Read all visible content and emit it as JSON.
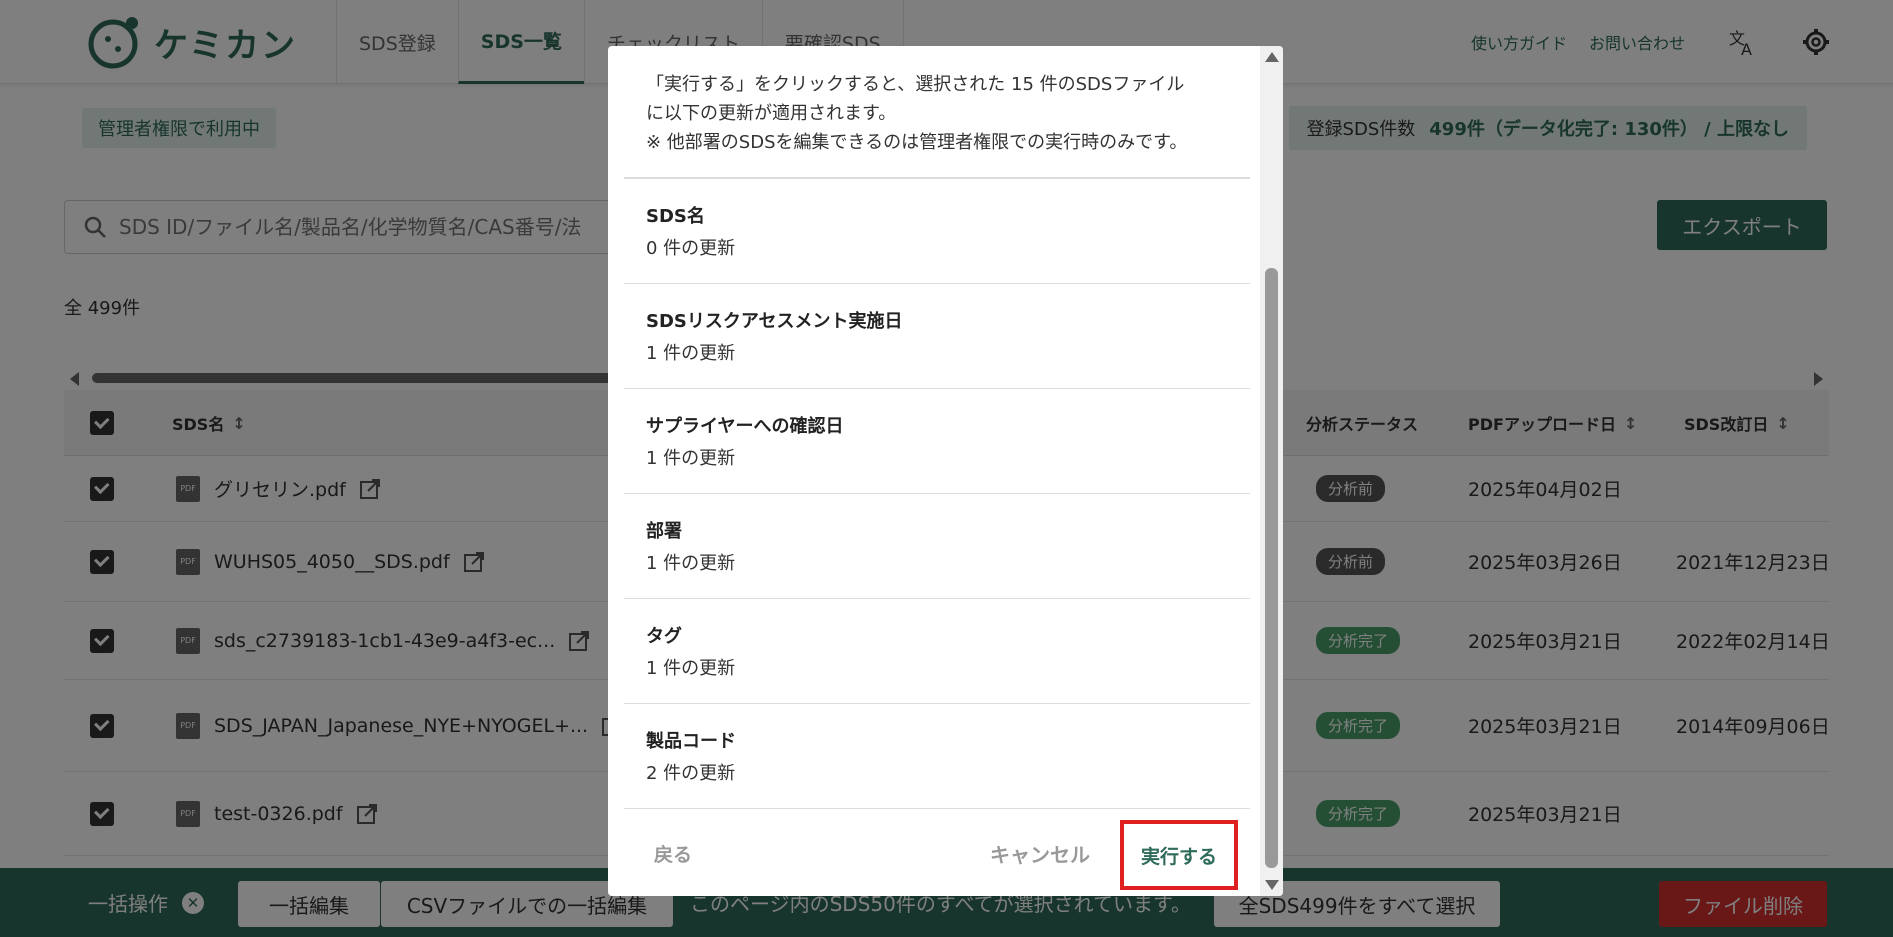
{
  "app": {
    "logo_text": "ケミカン"
  },
  "nav": {
    "tabs": [
      {
        "label": "SDS登録"
      },
      {
        "label": "SDS一覧"
      },
      {
        "label": "チェックリスト"
      },
      {
        "label": "要確認SDS"
      }
    ],
    "active_index": 1
  },
  "header": {
    "guide_link": "使い方ガイド",
    "contact_link": "お問い合わせ"
  },
  "page": {
    "admin_badge": "管理者権限で利用中",
    "sds_count_label": "登録SDS件数",
    "sds_count_value": "499件（データ化完了: 130件） / 上限なし",
    "search_placeholder": "SDS ID/ファイル名/製品名/化学物質名/CAS番号/法",
    "export_label": "エクスポート",
    "total_label": "全 499件"
  },
  "table": {
    "headers": {
      "name": "SDS名",
      "status": "分析ステータス",
      "upload_date": "PDFアップロード日",
      "revision_date": "SDS改訂日"
    },
    "rows": [
      {
        "name": "グリセリン.pdf",
        "status": "分析前",
        "status_type": "before",
        "upload_date": "2025年04月02日",
        "revision_date": ""
      },
      {
        "name": "WUHS05_4050__SDS.pdf",
        "status": "分析前",
        "status_type": "before",
        "upload_date": "2025年03月26日",
        "revision_date": "2021年12月23日"
      },
      {
        "name": "sds_c2739183-1cb1-43e9-a4f3-ec...",
        "status": "分析完了",
        "status_type": "done",
        "upload_date": "2025年03月21日",
        "revision_date": "2022年02月14日"
      },
      {
        "name": "SDS_JAPAN_Japanese_NYE+NYOGEL+...",
        "status": "分析完了",
        "status_type": "done",
        "upload_date": "2025年03月21日",
        "revision_date": "2014年09月06日"
      },
      {
        "name": "test-0326.pdf",
        "status": "分析完了",
        "status_type": "done",
        "upload_date": "2025年03月21日",
        "revision_date": ""
      }
    ]
  },
  "bottom_bar": {
    "bulk_label": "一括操作",
    "bulk_edit": "一括編集",
    "csv_edit": "CSVファイルでの一括編集",
    "selection_text": "このページ内のSDS50件のすべてが選択されています。",
    "select_all": "全SDS499件をすべて選択",
    "delete": "ファイル削除"
  },
  "modal": {
    "intro_line1": "「実行する」をクリックすると、選択された 15 件のSDSファイル",
    "intro_line2": "に以下の更新が適用されます。",
    "intro_line3": "※ 他部署のSDSを編集できるのは管理者権限での実行時のみです。",
    "fields": [
      {
        "name": "SDS名",
        "count": "0 件の更新"
      },
      {
        "name": "SDSリスクアセスメント実施日",
        "count": "1 件の更新"
      },
      {
        "name": "サプライヤーへの確認日",
        "count": "1 件の更新"
      },
      {
        "name": "部署",
        "count": "1 件の更新"
      },
      {
        "name": "タグ",
        "count": "1 件の更新"
      },
      {
        "name": "製品コード",
        "count": "2 件の更新"
      }
    ],
    "back": "戻る",
    "cancel": "キャンセル",
    "execute": "実行する"
  },
  "colors": {
    "brand": "#2f6b5a",
    "danger": "#d32f2f",
    "highlight": "#e02020"
  }
}
